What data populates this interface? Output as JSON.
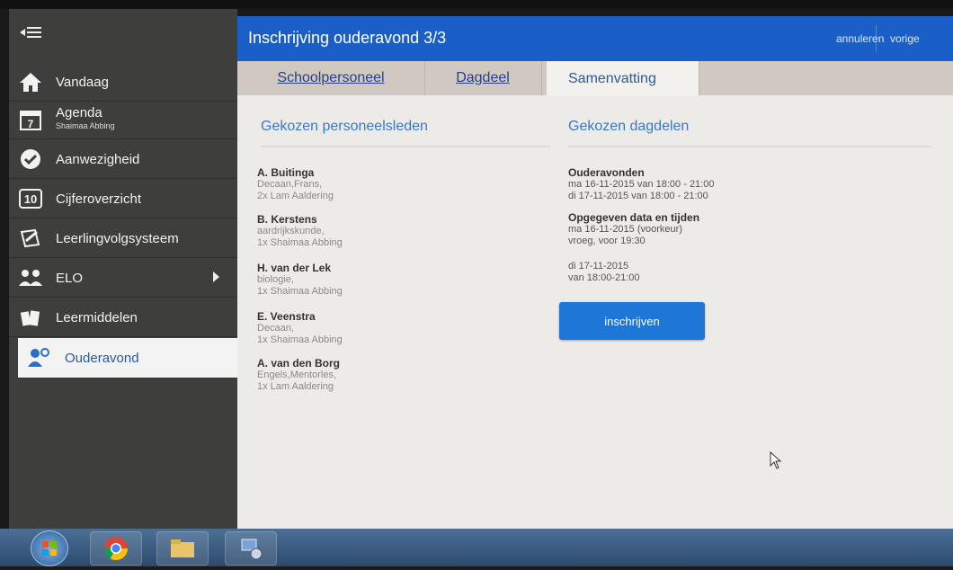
{
  "sidebar": {
    "items": [
      {
        "label": "Vandaag",
        "sub": ""
      },
      {
        "label": "Agenda",
        "sub": "Shaimaa Abbing"
      },
      {
        "label": "Aanwezigheid",
        "sub": ""
      },
      {
        "label": "Cijferoverzicht",
        "sub": ""
      },
      {
        "label": "Leerlingvolgsysteem",
        "sub": ""
      },
      {
        "label": "ELO",
        "sub": ""
      },
      {
        "label": "Leermiddelen",
        "sub": ""
      },
      {
        "label": "Ouderavond",
        "sub": ""
      }
    ],
    "agenda_day": "7",
    "cijfer_badge": "10"
  },
  "header": {
    "title": "Inschrijving ouderavond 3/3",
    "cancel": "annuleren",
    "previous": "vorige"
  },
  "tabs": [
    "Schoolpersoneel",
    "Dagdeel",
    "Samenvatting"
  ],
  "left_column": {
    "heading": "Gekozen personeelsleden",
    "people": [
      {
        "name": "A. Buitinga",
        "subjects": "Decaan,Frans,",
        "children": "2x Lam Aaldering"
      },
      {
        "name": "B. Kerstens",
        "subjects": "aardrijkskunde,",
        "children": "1x Shaimaa Abbing"
      },
      {
        "name": "H. van der Lek",
        "subjects": "biologie,",
        "children": "1x Shaimaa Abbing"
      },
      {
        "name": "E. Veenstra",
        "subjects": "Decaan,",
        "children": "1x Shaimaa Abbing"
      },
      {
        "name": "A. van den Borg",
        "subjects": "Engels,Mentorles,",
        "children": "1x Lam Aaldering"
      }
    ]
  },
  "right_column": {
    "heading": "Gekozen dagdelen",
    "ouderavonden_title": "Ouderavonden",
    "ouderavonden": [
      "ma 16-11-2015 van 18:00 - 21:00",
      "di 17-11-2015 van 18:00 - 21:00"
    ],
    "opgegeven_title": "Opgegeven data en tijden",
    "opgegeven_1": [
      "ma 16-11-2015 (voorkeur)",
      "vroeg, voor 19:30"
    ],
    "opgegeven_2": [
      "di 17-11-2015",
      "van 18:00-21:00"
    ],
    "button": "inschrijven"
  },
  "colors": {
    "header": "#1a5fc7",
    "sidebar": "#3e3e3c",
    "accent": "#3a78c8",
    "button": "#1e76d6"
  }
}
